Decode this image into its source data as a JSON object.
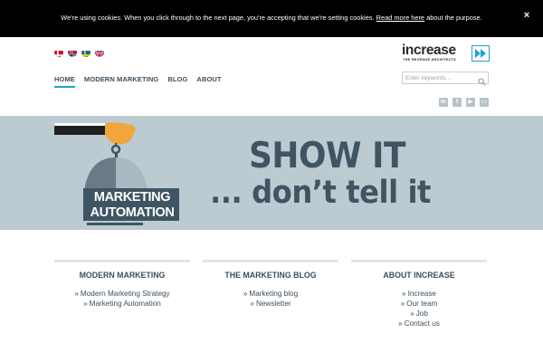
{
  "cookie_bar": {
    "text_before": "We're using cookies. When you click through to the next page, you're accepting that we're setting cookies. ",
    "link_text": "Read more here",
    "text_after": " about the purpose.",
    "close_label": "×"
  },
  "languages": [
    {
      "name": "danish-flag-icon"
    },
    {
      "name": "norwegian-flag-icon"
    },
    {
      "name": "swedish-flag-icon"
    },
    {
      "name": "english-flag-icon"
    }
  ],
  "nav": {
    "items": [
      {
        "label": "HOME",
        "active": true
      },
      {
        "label": "MODERN MARKETING",
        "active": false
      },
      {
        "label": "BLOG",
        "active": false
      },
      {
        "label": "ABOUT",
        "active": false
      }
    ]
  },
  "logo": {
    "word": "increase",
    "tagline": "THE REVENUE ARCHITECTS"
  },
  "search": {
    "placeholder": "Enter keywords..."
  },
  "social": [
    {
      "icon": "linkedin-icon",
      "glyph": "in"
    },
    {
      "icon": "facebook-icon",
      "glyph": "f"
    },
    {
      "icon": "youtube-icon",
      "glyph": "▶"
    },
    {
      "icon": "slideshare-icon",
      "glyph": "▭"
    }
  ],
  "hero": {
    "badge_line1": "MARKETING",
    "badge_line2": "AUTOMATION",
    "heading": "SHOW IT",
    "subheading": "... don’t tell it"
  },
  "footer": {
    "columns": [
      {
        "title": "MODERN MARKETING",
        "links": [
          "Modern Marketing Strategy",
          "Marketing Automation"
        ]
      },
      {
        "title": "THE MARKETING BLOG",
        "links": [
          "Marketing blog",
          "Newsletter"
        ]
      },
      {
        "title": "ABOUT INCREASE",
        "links": [
          "Increase",
          "Our team",
          "Job",
          "Contact us"
        ]
      }
    ],
    "arrow": "»"
  },
  "colors": {
    "accent": "#1fa1d0",
    "text": "#3d4f5c",
    "hero_bg": "#bccbd1",
    "hand_orange": "#f0a63b"
  }
}
